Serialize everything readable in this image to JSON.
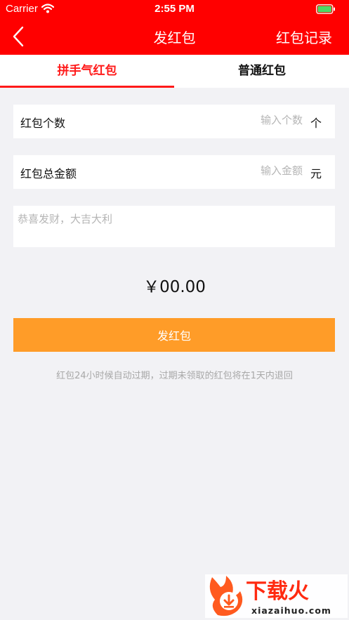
{
  "status_bar": {
    "carrier": "Carrier",
    "time": "2:55 PM",
    "icons": [
      "wifi-icon",
      "battery-icon"
    ]
  },
  "nav": {
    "back_icon": "chevron-left-icon",
    "title": "发红包",
    "right_label": "红包记录"
  },
  "tabs": [
    {
      "label": "拼手气红包",
      "active": true
    },
    {
      "label": "普通红包",
      "active": false
    }
  ],
  "form": {
    "count": {
      "label": "红包个数",
      "placeholder": "输入个数",
      "value": "",
      "unit": "个"
    },
    "amount": {
      "label": "红包总金额",
      "placeholder": "输入金额",
      "value": "",
      "unit": "元"
    },
    "message": {
      "placeholder": "恭喜发财，大吉大利",
      "value": ""
    }
  },
  "total": "￥00.00",
  "submit_label": "发红包",
  "hint": "红包24小时候自动过期，过期未领取的红包将在1天内退回",
  "watermark": {
    "text": "下载火",
    "url_text": "xiazaihuo.com"
  },
  "colors": {
    "header": "#ff0000",
    "tab_active": "#ff1a1a",
    "button": "#ff9c28",
    "background": "#f2f2f5"
  }
}
